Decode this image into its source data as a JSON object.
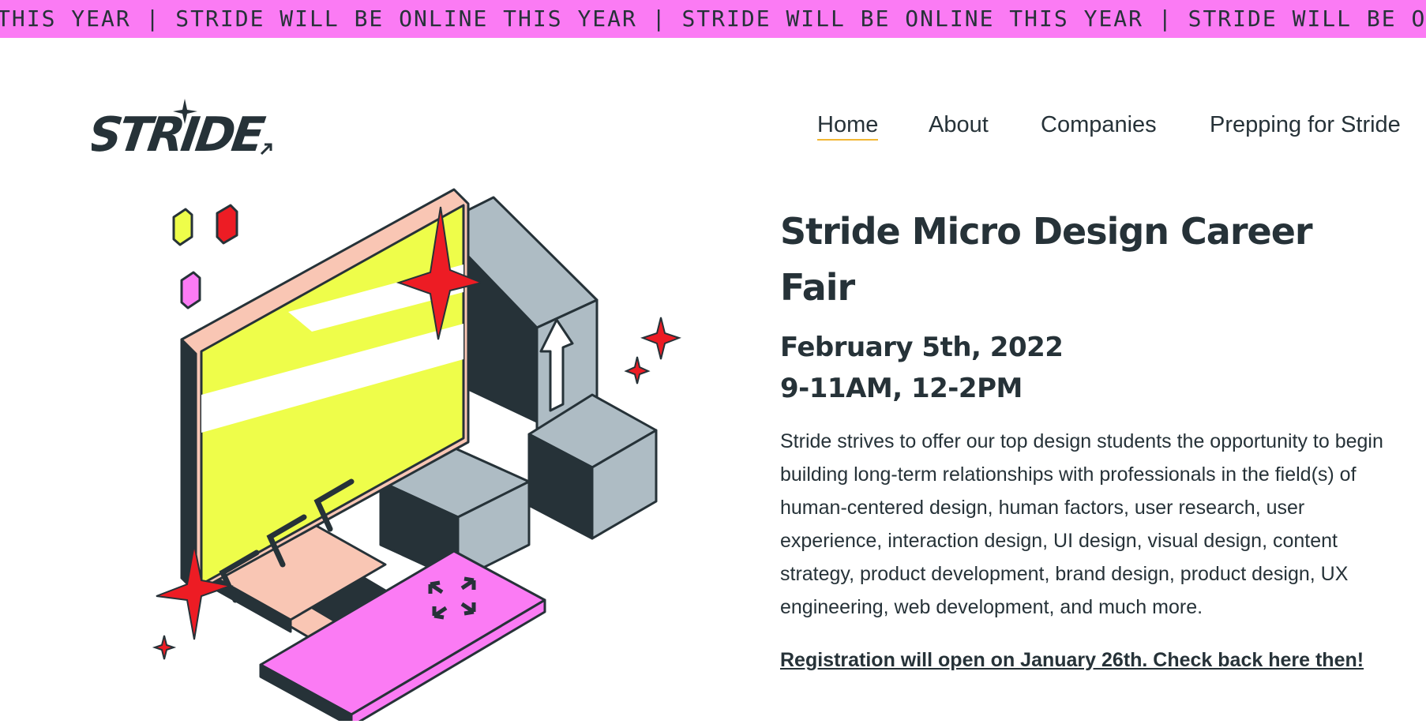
{
  "ticker": {
    "text": "THIS YEAR | STRIDE WILL BE ONLINE THIS YEAR | STRIDE WILL BE ONLINE THIS YEAR | STRIDE WILL BE ONLINE"
  },
  "logo": {
    "text": "STRIDE"
  },
  "nav": {
    "items": [
      {
        "label": "Home",
        "active": true
      },
      {
        "label": "About"
      },
      {
        "label": "Companies"
      },
      {
        "label": "Prepping for Stride"
      }
    ]
  },
  "event": {
    "title": "Stride Micro Design Career Fair",
    "date": "February 5th, 2022",
    "time": "9-11AM, 12-2PM",
    "description": "Stride strives to offer our top design students the opportunity to begin building long-term relationships with professionals in the field(s) of human-centered design, human factors, user research, user experience, interaction design, UI design, visual design, content strategy, product development, brand design, product design, UX engineering, web development, and much more.",
    "registration_note": "Registration will open on January 26th. Check back here then!"
  },
  "colors": {
    "ticker_bg": "#fb7bf4",
    "text_dark": "#263238",
    "nav_active_underline": "#f2b632",
    "screen_yellow": "#eefd4a",
    "monitor_pink": "#f9c6b4",
    "keyboard_pink": "#fb7bf4",
    "sparkle_red": "#ed1c24",
    "box_grey": "#aebcc4"
  },
  "icons": [
    "sparkle-icon",
    "arrow-up-icon",
    "arrows-left-icon",
    "expand-arrows-icon"
  ]
}
